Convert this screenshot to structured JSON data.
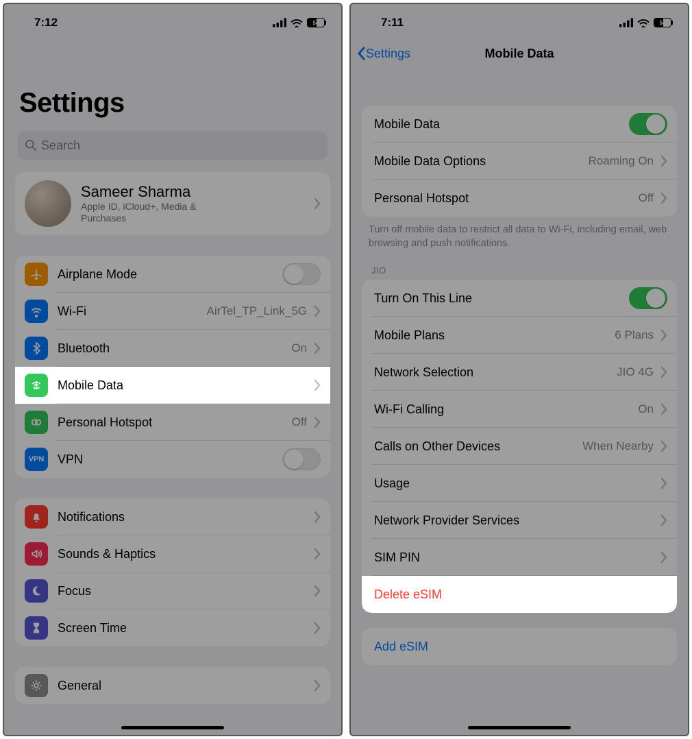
{
  "left": {
    "status": {
      "time": "7:12",
      "battery": "54"
    },
    "title": "Settings",
    "search_placeholder": "Search",
    "profile": {
      "name": "Sameer Sharma",
      "sub": "Apple ID, iCloud+, Media & Purchases"
    },
    "group1": {
      "airplane": "Airplane Mode",
      "wifi": {
        "label": "Wi-Fi",
        "detail": "AirTel_TP_Link_5G"
      },
      "bluetooth": {
        "label": "Bluetooth",
        "detail": "On"
      },
      "mobile": "Mobile Data",
      "hotspot": {
        "label": "Personal Hotspot",
        "detail": "Off"
      },
      "vpn": "VPN"
    },
    "group2": {
      "notifications": "Notifications",
      "sounds": "Sounds & Haptics",
      "focus": "Focus",
      "screentime": "Screen Time"
    },
    "group3": {
      "general": "General"
    }
  },
  "right": {
    "status": {
      "time": "7:11",
      "battery": "54"
    },
    "nav": {
      "back": "Settings",
      "title": "Mobile Data"
    },
    "group1": {
      "mobile_data": "Mobile Data",
      "options": {
        "label": "Mobile Data Options",
        "detail": "Roaming On"
      },
      "hotspot": {
        "label": "Personal Hotspot",
        "detail": "Off"
      }
    },
    "footer1": "Turn off mobile data to restrict all data to Wi-Fi, including email, web browsing and push notifications.",
    "section_head": "JIO",
    "group2": {
      "turn_on": "Turn On This Line",
      "plans": {
        "label": "Mobile Plans",
        "detail": "6 Plans"
      },
      "network": {
        "label": "Network Selection",
        "detail": "JIO 4G"
      },
      "wifi_calling": {
        "label": "Wi-Fi Calling",
        "detail": "On"
      },
      "other_devices": {
        "label": "Calls on Other Devices",
        "detail": "When Nearby"
      },
      "usage": "Usage",
      "provider": "Network Provider Services",
      "sim_pin": "SIM PIN",
      "delete_esim": "Delete eSIM"
    },
    "group3": {
      "add_esim": "Add eSIM"
    }
  },
  "icons": {
    "airplane_color": "#ff9500",
    "wifi_color": "#007aff",
    "bluetooth_color": "#007aff",
    "mobile_color": "#34c759",
    "hotspot_color": "#34c759",
    "vpn_color": "#007aff",
    "notifications_color": "#ff3b30",
    "sounds_color": "#ff2d55",
    "focus_color": "#5856d6",
    "screentime_color": "#5856d6",
    "general_color": "#8e8e93"
  }
}
